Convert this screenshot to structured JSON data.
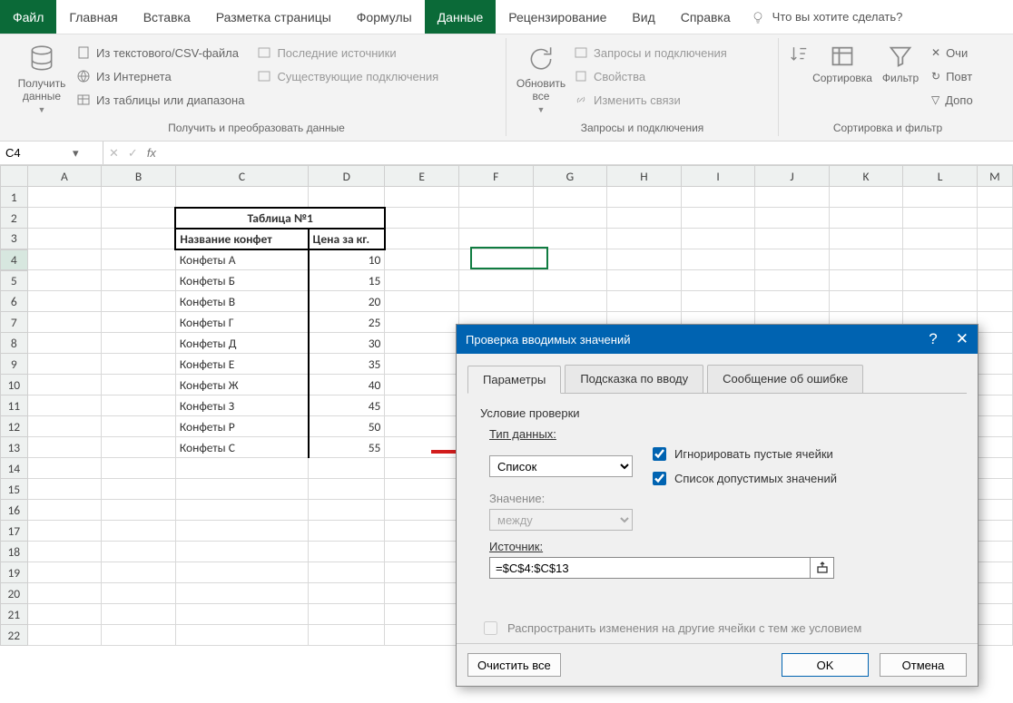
{
  "menu": {
    "file": "Файл",
    "home": "Главная",
    "insert": "Вставка",
    "layout": "Разметка страницы",
    "formulas": "Формулы",
    "data": "Данные",
    "review": "Рецензирование",
    "view": "Вид",
    "help": "Справка",
    "tellme": "Что вы хотите сделать?"
  },
  "ribbon": {
    "get_data": "Получить данные",
    "from_csv": "Из текстового/CSV-файла",
    "from_web": "Из Интернета",
    "from_range": "Из таблицы или диапазона",
    "recent": "Последние источники",
    "existing": "Существующие подключения",
    "group1": "Получить и преобразовать данные",
    "refresh": "Обновить все",
    "queries": "Запросы и подключения",
    "properties": "Свойства",
    "edit_links": "Изменить связи",
    "group2": "Запросы и подключения",
    "sort": "Сортировка",
    "filter": "Фильтр",
    "clear": "Очи",
    "reapply": "Повт",
    "advanced": "Допо",
    "group3": "Сортировка и фильтр"
  },
  "namebox": "C4",
  "table": {
    "title": "Таблица №1",
    "hdr_name": "Название конфет",
    "hdr_price": "Цена за кг.",
    "rows": [
      {
        "name": "Конфеты А",
        "price": "10"
      },
      {
        "name": "Конфеты Б",
        "price": "15"
      },
      {
        "name": "Конфеты В",
        "price": "20"
      },
      {
        "name": "Конфеты Г",
        "price": "25"
      },
      {
        "name": "Конфеты Д",
        "price": "30"
      },
      {
        "name": "Конфеты Е",
        "price": "35"
      },
      {
        "name": "Конфеты Ж",
        "price": "40"
      },
      {
        "name": "Конфеты З",
        "price": "45"
      },
      {
        "name": "Конфеты Р",
        "price": "50"
      },
      {
        "name": "Конфеты С",
        "price": "55"
      }
    ]
  },
  "cols": [
    "A",
    "B",
    "C",
    "D",
    "E",
    "F",
    "G",
    "H",
    "I",
    "J",
    "K",
    "L",
    "M"
  ],
  "dialog": {
    "title": "Проверка вводимых значений",
    "tab_params": "Параметры",
    "tab_input": "Подсказка по вводу",
    "tab_error": "Сообщение об ошибке",
    "cond": "Условие проверки",
    "type_label": "Тип данных:",
    "type_value": "Список",
    "ignore_empty": "Игнорировать пустые ячейки",
    "dropdown_list": "Список допустимых значений",
    "value_label": "Значение:",
    "value_value": "между",
    "source_label": "Источник:",
    "source_value": "=$C$4:$C$13",
    "spread": "Распространить изменения на другие ячейки с тем же условием",
    "clear_all": "Очистить все",
    "ok": "OK",
    "cancel": "Отмена"
  }
}
